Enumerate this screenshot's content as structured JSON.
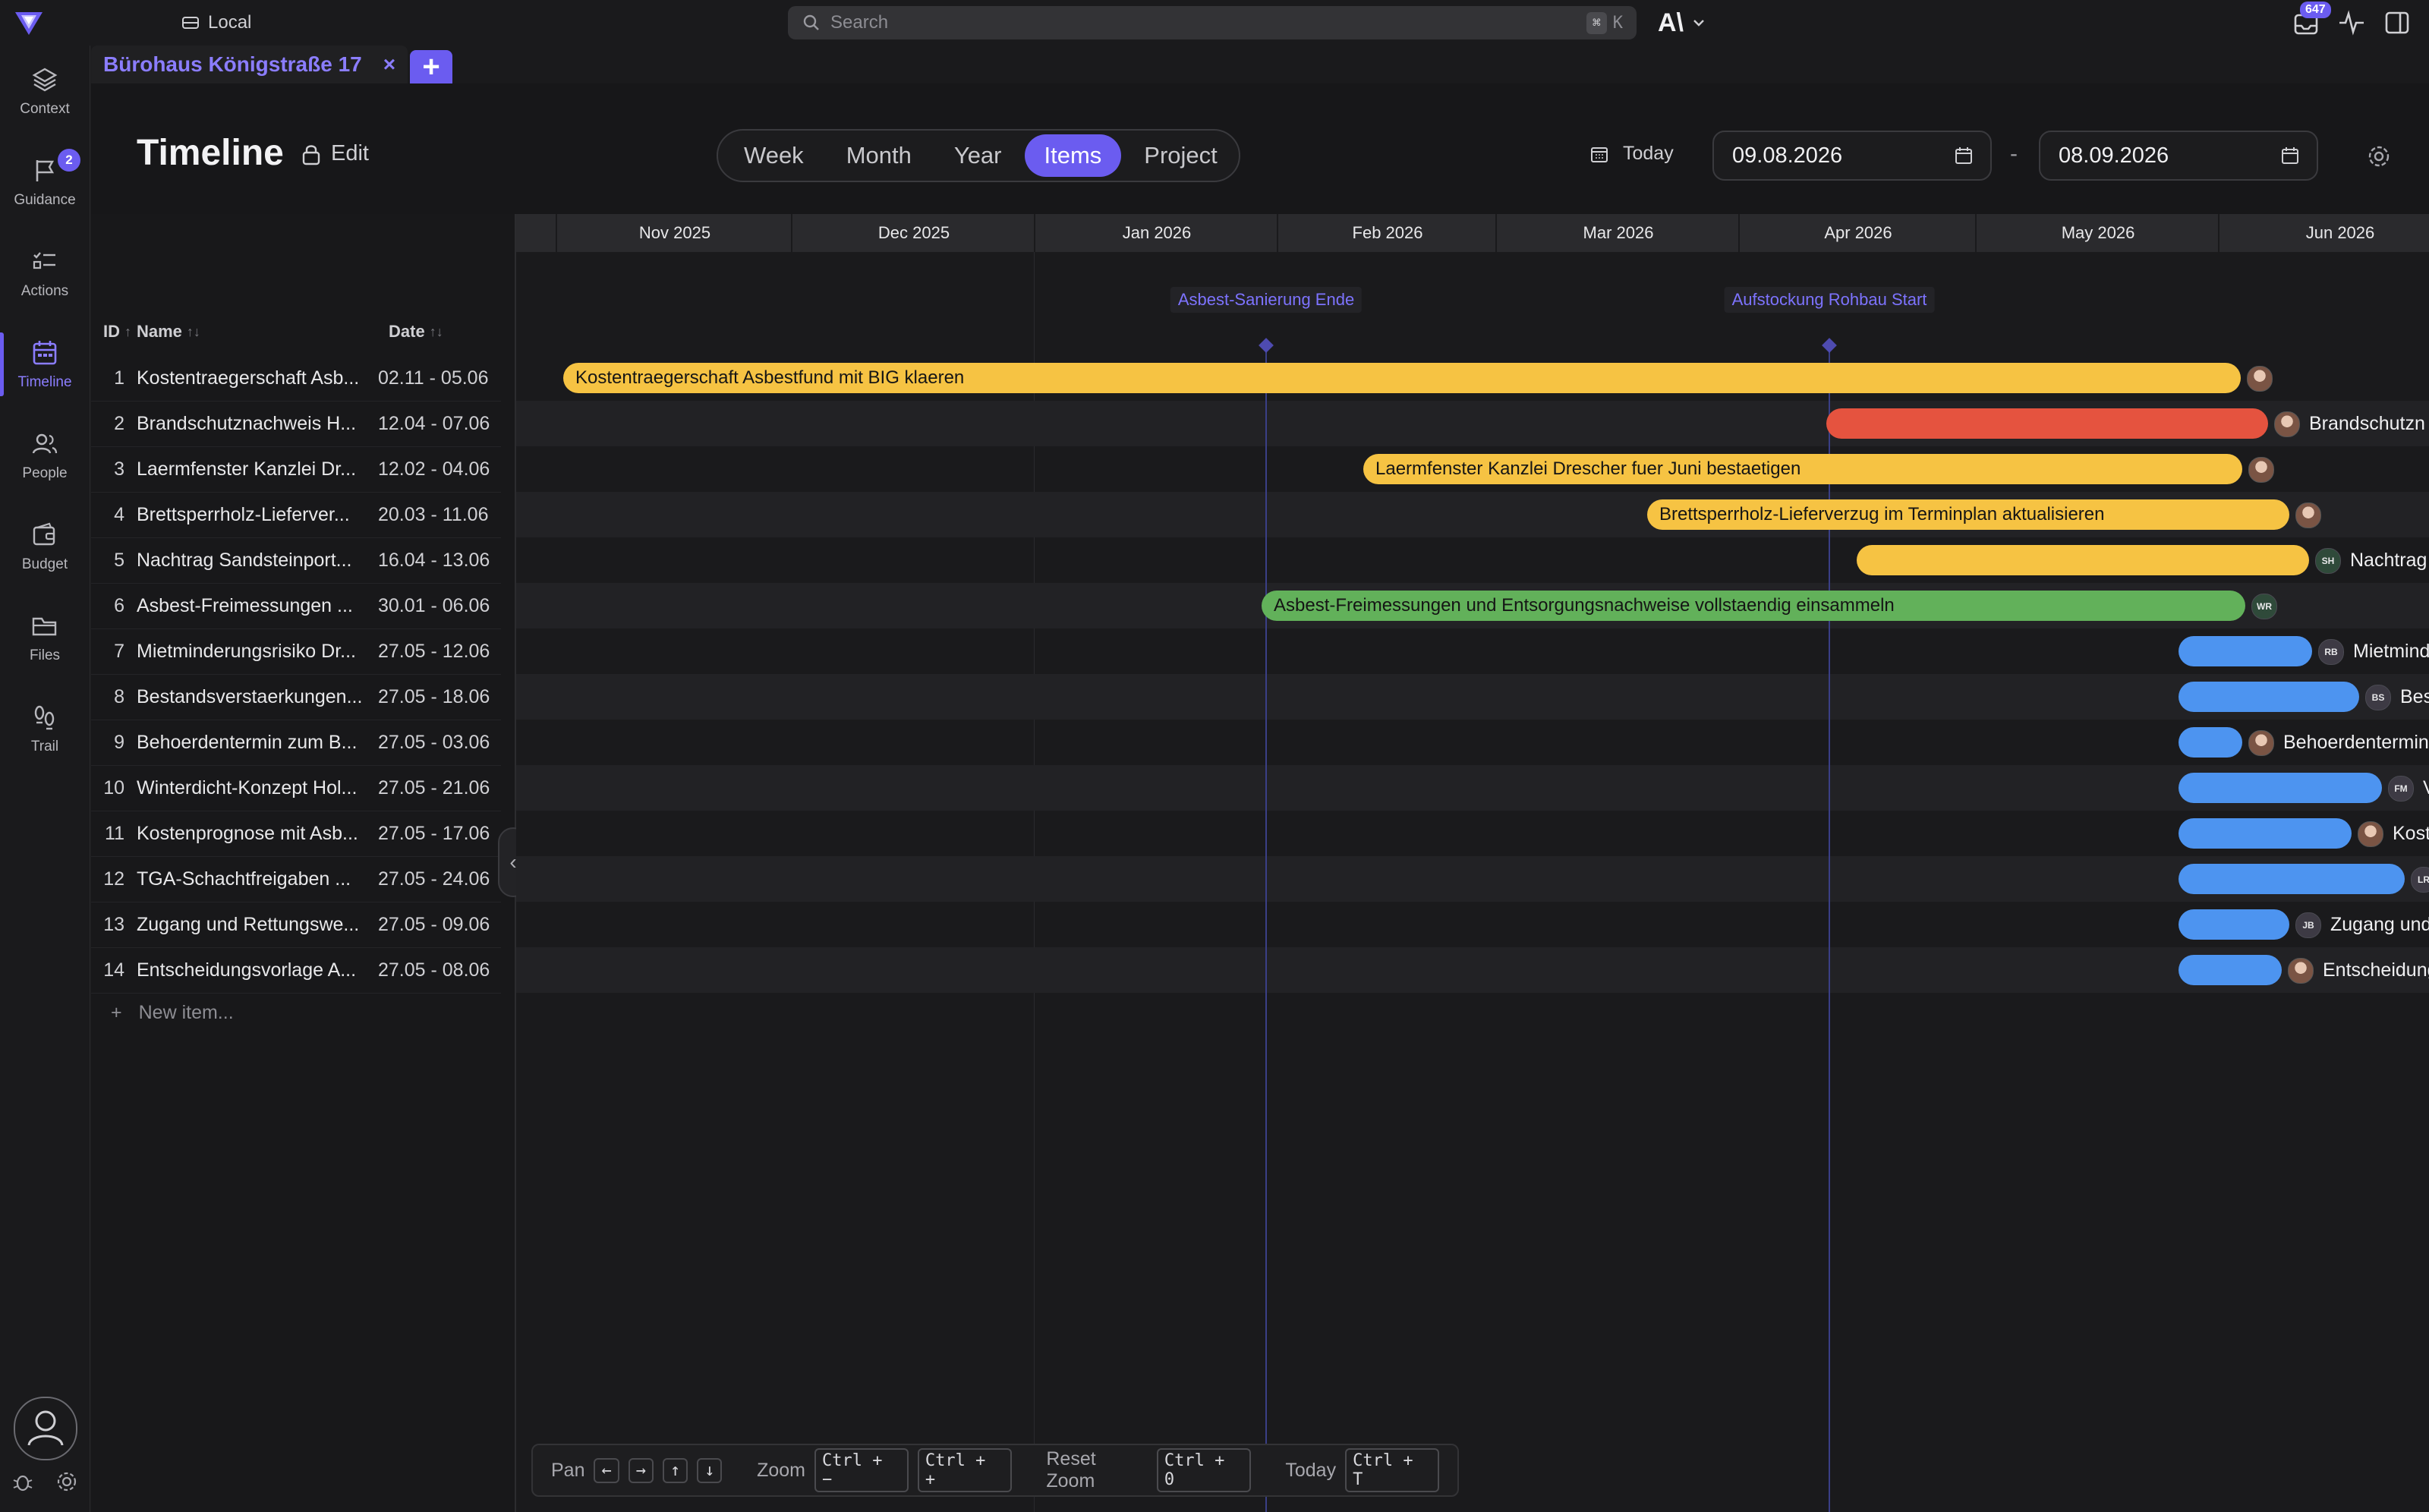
{
  "topbar": {
    "workspace": "Local",
    "search_placeholder": "Search",
    "search_shortcut_mod": "⌘",
    "search_shortcut_key": "K",
    "brand": "A\\",
    "inbox_count": "647"
  },
  "rail": {
    "items": [
      {
        "label": "Context",
        "icon": "layers-icon"
      },
      {
        "label": "Guidance",
        "icon": "flag-icon",
        "badge": "2"
      },
      {
        "label": "Actions",
        "icon": "checklist-icon"
      },
      {
        "label": "Timeline",
        "icon": "calendar-icon",
        "active": true
      },
      {
        "label": "People",
        "icon": "people-icon"
      },
      {
        "label": "Budget",
        "icon": "wallet-icon"
      },
      {
        "label": "Files",
        "icon": "folder-icon"
      },
      {
        "label": "Trail",
        "icon": "footsteps-icon"
      }
    ]
  },
  "tabs": {
    "active": "Bürohaus Königstraße 17",
    "close": "×",
    "add": "+"
  },
  "header": {
    "title": "Timeline",
    "edit": "Edit",
    "views": [
      "Week",
      "Month",
      "Year",
      "Items",
      "Project"
    ],
    "active_view": "Items",
    "today": "Today",
    "date_start": "09.08.2026",
    "date_end": "08.09.2026",
    "date_sep": "-"
  },
  "list": {
    "columns": {
      "id": "ID",
      "name": "Name",
      "date": "Date"
    },
    "new_item": "New item...",
    "new_item_plus": "+",
    "rows": [
      {
        "id": "1",
        "name": "Kostentraegerschaft Asb...",
        "date": "02.11 - 05.06"
      },
      {
        "id": "2",
        "name": "Brandschutznachweis H...",
        "date": "12.04 - 07.06"
      },
      {
        "id": "3",
        "name": "Laermfenster Kanzlei Dr...",
        "date": "12.02 - 04.06"
      },
      {
        "id": "4",
        "name": "Brettsperrholz-Lieferver...",
        "date": "20.03 - 11.06"
      },
      {
        "id": "5",
        "name": "Nachtrag Sandsteinport...",
        "date": "16.04 - 13.06"
      },
      {
        "id": "6",
        "name": "Asbest-Freimessungen ...",
        "date": "30.01 - 06.06"
      },
      {
        "id": "7",
        "name": "Mietminderungsrisiko Dr...",
        "date": "27.05 - 12.06"
      },
      {
        "id": "8",
        "name": "Bestandsverstaerkungen...",
        "date": "27.05 - 18.06"
      },
      {
        "id": "9",
        "name": "Behoerdentermin zum B...",
        "date": "27.05 - 03.06"
      },
      {
        "id": "10",
        "name": "Winterdicht-Konzept Hol...",
        "date": "27.05 - 21.06"
      },
      {
        "id": "11",
        "name": "Kostenprognose mit Asb...",
        "date": "27.05 - 17.06"
      },
      {
        "id": "12",
        "name": "TGA-Schachtfreigaben ...",
        "date": "27.05 - 24.06"
      },
      {
        "id": "13",
        "name": "Zugang und Rettungswe...",
        "date": "27.05 - 09.06"
      },
      {
        "id": "14",
        "name": "Entscheidungsvorlage A...",
        "date": "27.05 - 08.06"
      }
    ]
  },
  "timeline": {
    "months": [
      "Nov 2025",
      "Dec 2025",
      "Jan 2026",
      "Feb 2026",
      "Mar 2026",
      "Apr 2026",
      "May 2026",
      "Jun 2026"
    ],
    "milestones": [
      {
        "label": "Asbest-Sanierung Ende"
      },
      {
        "label": "Aufstockung Rohbau Start"
      }
    ],
    "bars": [
      {
        "label": "Kostentraegerschaft Asbestfund mit BIG klaeren",
        "color": "#f6c343",
        "outside": "",
        "avatar": ""
      },
      {
        "label": "",
        "color": "#e5533f",
        "outside": "Brandschutzn",
        "avatar": ""
      },
      {
        "label": "Laermfenster Kanzlei Drescher fuer Juni bestaetigen",
        "color": "#f6c343",
        "outside": "",
        "avatar": ""
      },
      {
        "label": "Brettsperrholz-Lieferverzug im Terminplan aktualisieren",
        "color": "#f6c343",
        "outside": "",
        "avatar": ""
      },
      {
        "label": "",
        "color": "#f6c343",
        "outside": "Nachtrag",
        "avatar": "SH"
      },
      {
        "label": "Asbest-Freimessungen und Entsorgungsnachweise vollstaendig einsammeln",
        "color": "#62b15a",
        "outside": "",
        "avatar": "WR"
      },
      {
        "label": "",
        "color": "#4d94f0",
        "outside": "Mietmind",
        "avatar": "RB"
      },
      {
        "label": "",
        "color": "#4d94f0",
        "outside": "Bes",
        "avatar": "BS"
      },
      {
        "label": "",
        "color": "#4d94f0",
        "outside": "Behoerdentermin",
        "avatar": ""
      },
      {
        "label": "",
        "color": "#4d94f0",
        "outside": "V",
        "avatar": "FM"
      },
      {
        "label": "",
        "color": "#4d94f0",
        "outside": "Kost",
        "avatar": ""
      },
      {
        "label": "",
        "color": "#4d94f0",
        "outside": "",
        "avatar": "LR"
      },
      {
        "label": "",
        "color": "#4d94f0",
        "outside": "Zugang und",
        "avatar": "JB"
      },
      {
        "label": "",
        "color": "#4d94f0",
        "outside": "Entscheidung",
        "avatar": ""
      }
    ]
  },
  "shortcuts": {
    "pan": "Pan",
    "pan_keys": [
      "←",
      "→",
      "↑",
      "↓"
    ],
    "zoom": "Zoom",
    "zoom_out": "Ctrl + −",
    "zoom_in": "Ctrl + +",
    "reset": "Reset Zoom",
    "reset_key": "Ctrl + 0",
    "today": "Today",
    "today_key": "Ctrl + T"
  }
}
